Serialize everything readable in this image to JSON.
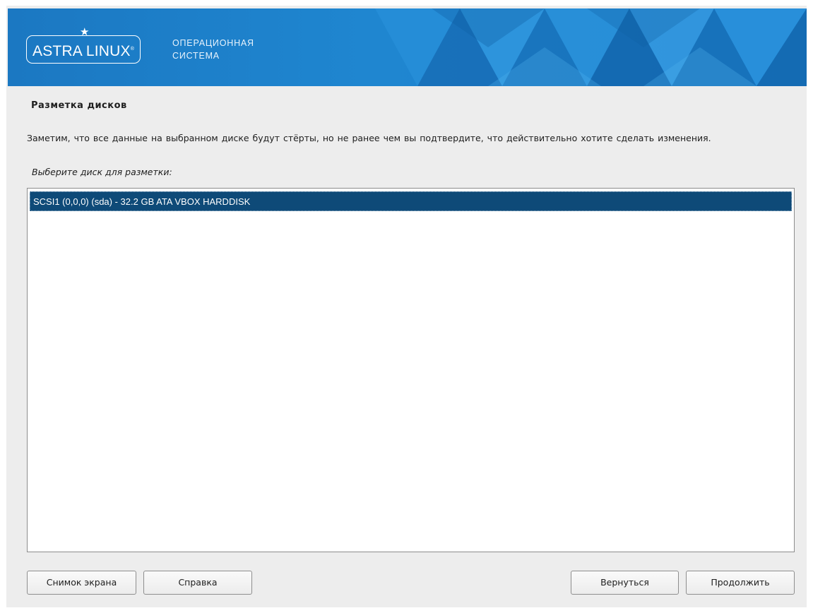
{
  "banner": {
    "logo_text": "ASTRA LINUX",
    "logo_reg": "®",
    "logo_star": "★",
    "caption_line1": "ОПЕРАЦИОННАЯ",
    "caption_line2": "СИСТЕМА",
    "colors": {
      "base": "#1c80cc",
      "light": "#3aa0e6",
      "dark": "#0f5fa3"
    }
  },
  "page": {
    "title": "Разметка дисков",
    "warning": "Заметим, что все данные на выбранном диске будут стёрты, но не ранее чем вы подтвердите, что действительно хотите сделать изменения.",
    "question": "Выберите диск для разметки:"
  },
  "disk_list": {
    "items": [
      {
        "label": "SCSI1 (0,0,0) (sda) - 32.2 GB ATA VBOX HARDDISK",
        "selected": true
      }
    ],
    "selection_color": "#0e4a78"
  },
  "buttons": {
    "screenshot": "Снимок экрана",
    "help": "Справка",
    "back": "Вернуться",
    "continue": "Продолжить"
  }
}
